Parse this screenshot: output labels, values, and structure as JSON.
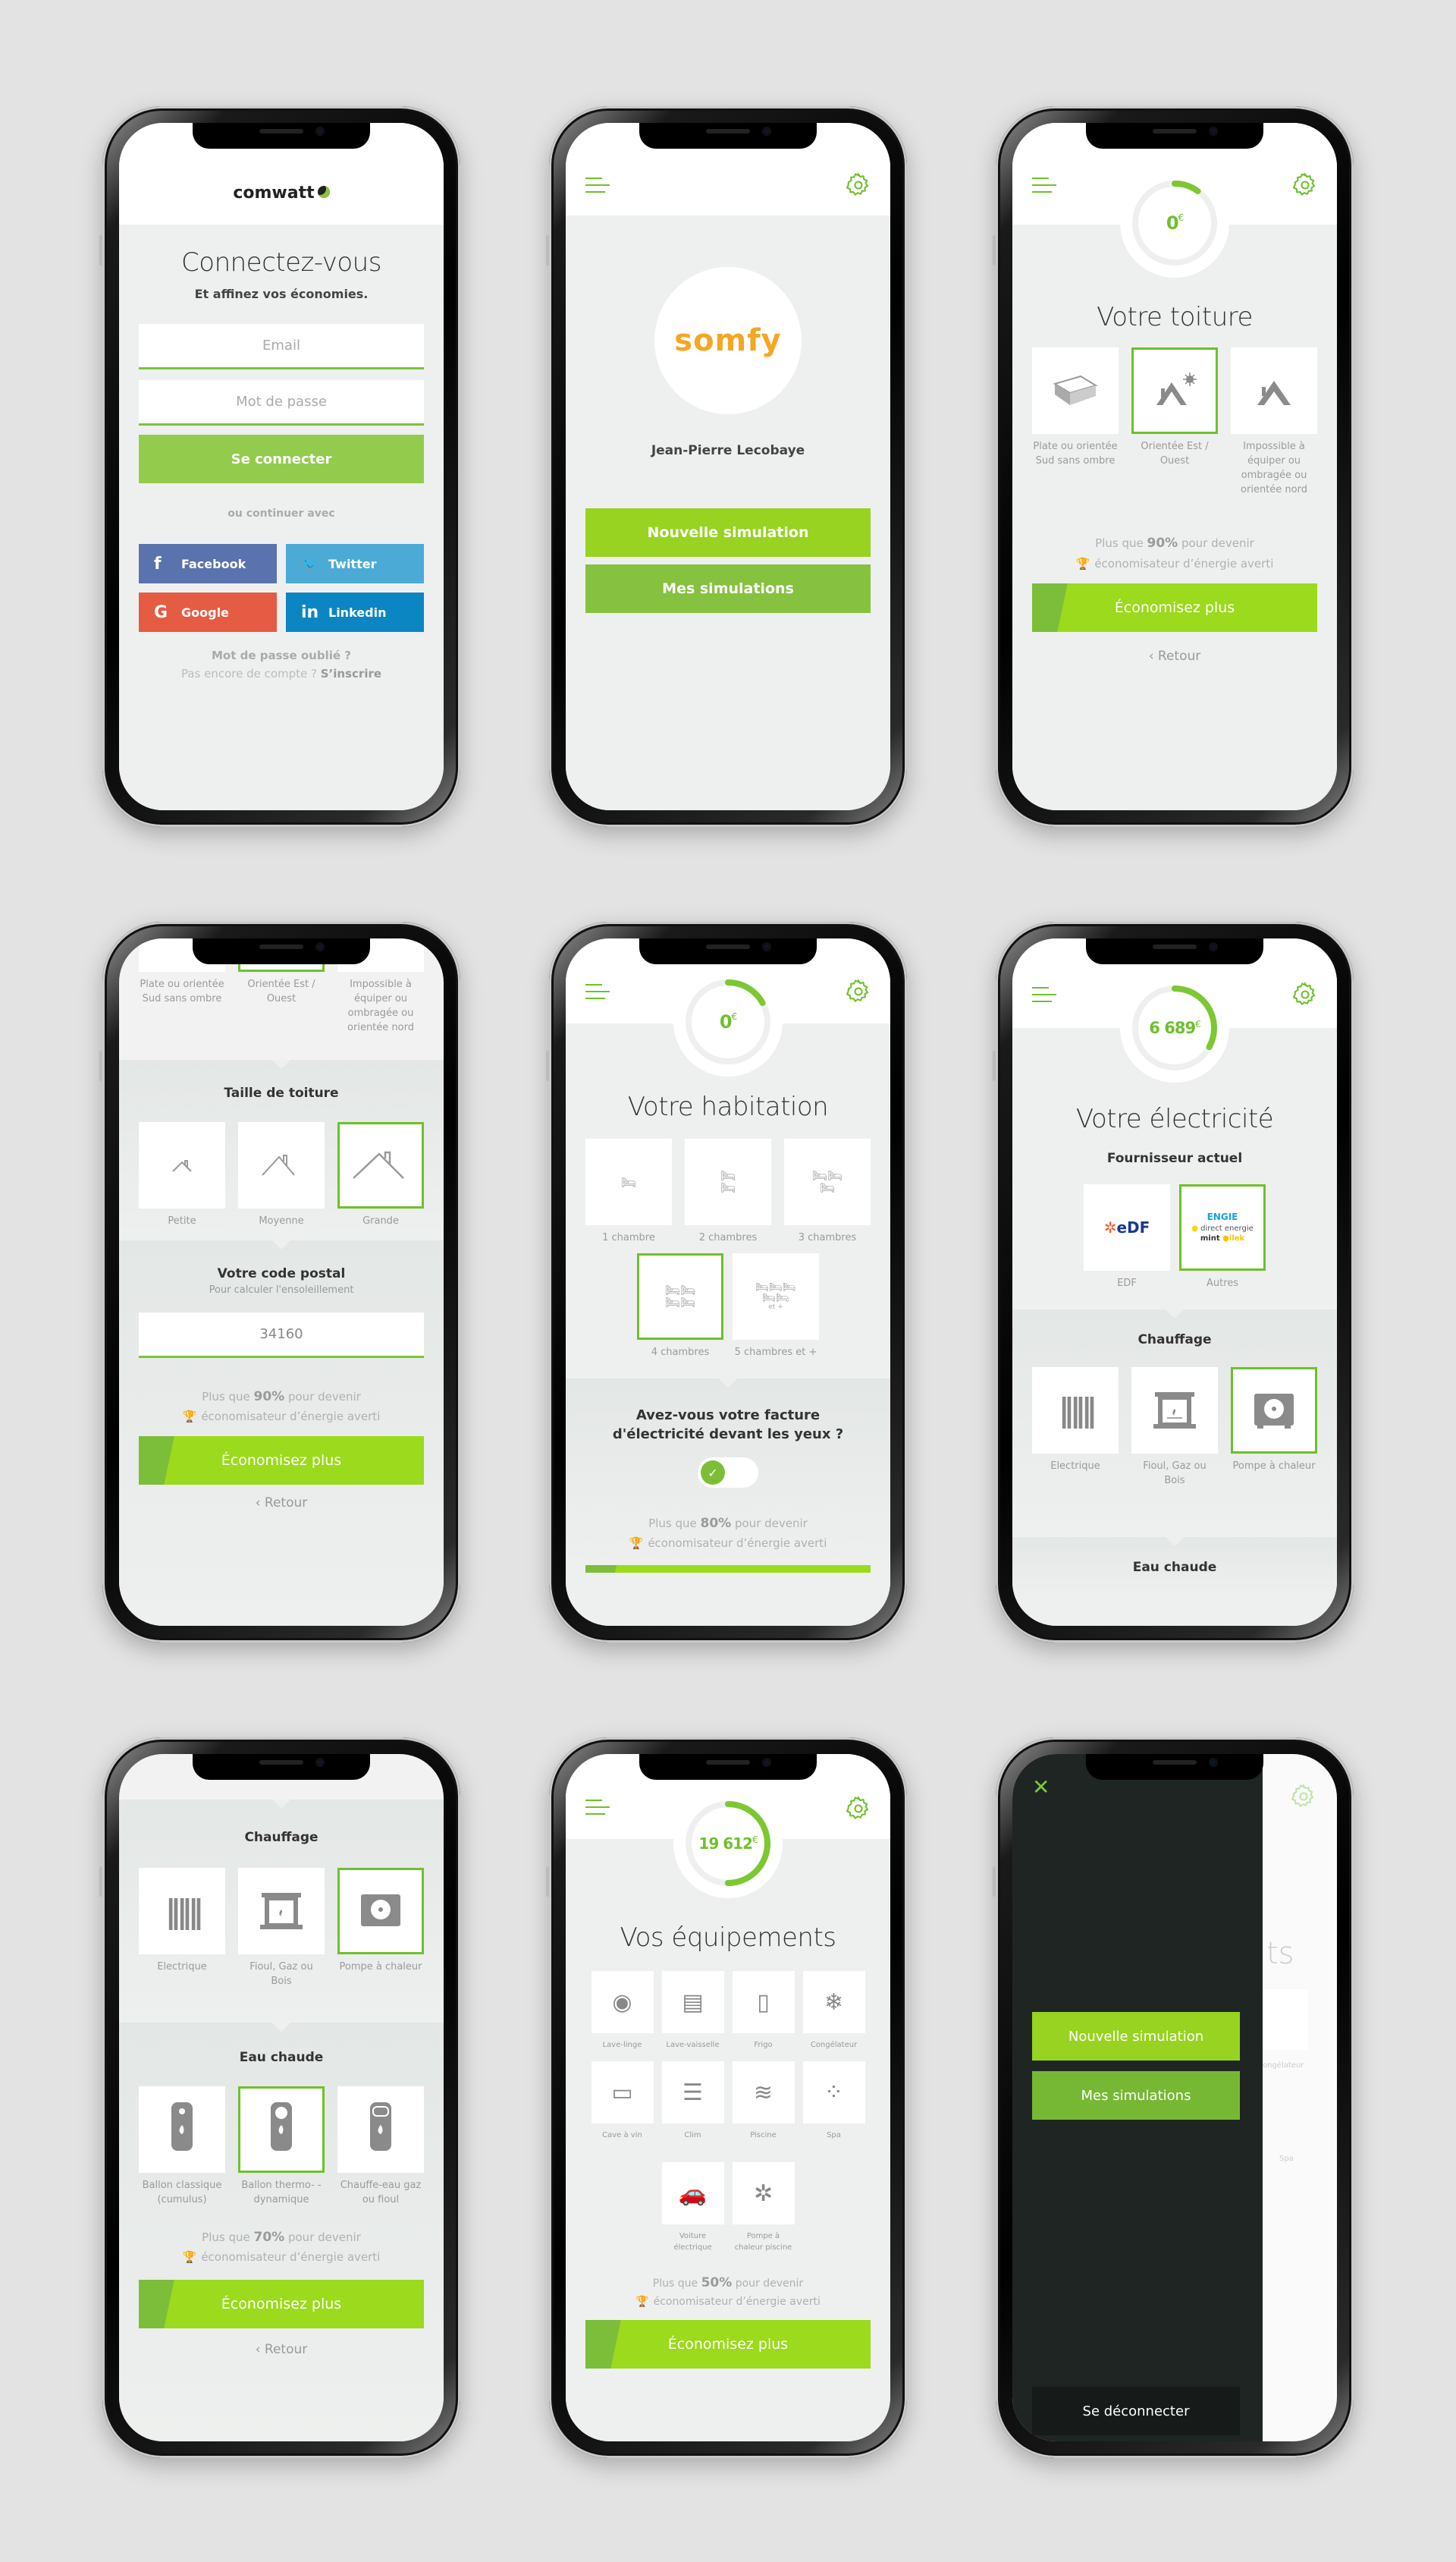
{
  "colors": {
    "accent": "#6fc02c",
    "lime": "#97d320",
    "green": "#86c140",
    "facebook": "#5a72ad",
    "twitter": "#4caad6",
    "google": "#e55b44",
    "linkedin": "#0b86c2",
    "drawer": "#1f2522"
  },
  "screens": {
    "login": {
      "logo": "comwatt",
      "title": "Connectez-vous",
      "subtitle": "Et affinez vos économies.",
      "email_placeholder": "Email",
      "password_placeholder": "Mot de passe",
      "login_button": "Se connecter",
      "or_continue": "ou continuer avec",
      "social": [
        {
          "label": "Facebook",
          "icon": "facebook-icon",
          "glyph": "f"
        },
        {
          "label": "Twitter",
          "icon": "twitter-icon",
          "glyph": "🐦"
        },
        {
          "label": "Google",
          "icon": "google-icon",
          "glyph": "G"
        },
        {
          "label": "Linkedin",
          "icon": "linkedin-icon",
          "glyph": "in"
        }
      ],
      "forgot_password": "Mot de passe oublié ?",
      "no_account": "Pas encore de compte ?",
      "signup": "S’inscrire"
    },
    "home": {
      "brand_logo": "somfy",
      "user_name": "Jean-Pierre Lecobaye",
      "new_simulation": "Nouvelle simulation",
      "my_simulations": "Mes simulations"
    },
    "roof": {
      "gauge_value": "0",
      "gauge_currency": "€",
      "gauge_progress": 0.1,
      "title": "Votre toiture",
      "options": [
        {
          "label": "Plate ou orientée Sud sans ombre",
          "icon": "flat-roof-icon",
          "selected": false
        },
        {
          "label": "Orientée Est / Ouest",
          "icon": "roof-sun-icon",
          "selected": true
        },
        {
          "label": "Impossible à équiper ou ombragée ou orientée nord",
          "icon": "roof-icon",
          "selected": false
        }
      ],
      "progress_prefix": "Plus que",
      "progress_percent": "90%",
      "progress_suffix": "pour devenir",
      "progress_line2": "économisateur d’énergie averti",
      "cta": "Économisez plus",
      "back": "Retour"
    },
    "roof_size": {
      "prev_options": [
        "Plate ou orientée Sud sans ombre",
        "Orientée Est / Ouest",
        "Impossible à équiper ou ombragée ou orientée nord"
      ],
      "section_title": "Taille de toiture",
      "options": [
        {
          "label": "Petite",
          "selected": false
        },
        {
          "label": "Moyenne",
          "selected": false
        },
        {
          "label": "Grande",
          "selected": true
        }
      ],
      "postal_title": "Votre code postal",
      "postal_subtitle": "Pour calculer l'ensoleillement",
      "postal_value": "34160",
      "progress_prefix": "Plus que",
      "progress_percent": "90%",
      "progress_suffix": "pour devenir",
      "progress_line2": "économisateur d’énergie averti",
      "cta": "Économisez plus",
      "back": "Retour"
    },
    "housing": {
      "gauge_value": "0",
      "gauge_currency": "€",
      "gauge_progress": 0.17,
      "title": "Votre habitation",
      "options": [
        {
          "label": "1 chambre",
          "beds": 1,
          "selected": false
        },
        {
          "label": "2 chambres",
          "beds": 2,
          "selected": false
        },
        {
          "label": "3 chambres",
          "beds": 3,
          "selected": false
        },
        {
          "label": "4 chambres",
          "beds": 4,
          "selected": true
        },
        {
          "label": "5 chambres et +",
          "beds": 5,
          "selected": false,
          "extra": "et +"
        }
      ],
      "question": "Avez-vous votre facture d'électricité devant les yeux ?",
      "toggle_on": true,
      "progress_prefix": "Plus que",
      "progress_percent": "80%",
      "progress_suffix": "pour devenir",
      "progress_line2": "économisateur d’énergie averti"
    },
    "electricity": {
      "gauge_value": "6 689",
      "gauge_currency": "€",
      "gauge_progress": 0.33,
      "title": "Votre électricité",
      "supplier_title": "Fournisseur actuel",
      "suppliers": [
        {
          "label": "EDF",
          "selected": false
        },
        {
          "label": "Autres",
          "selected": true,
          "logos": [
            "engie",
            "direct energie",
            "mint energie",
            "ilek"
          ]
        }
      ],
      "heating_title": "Chauffage",
      "heating": [
        {
          "label": "Electrique",
          "icon": "radiator-icon",
          "selected": false
        },
        {
          "label": "Fioul, Gaz ou Bois",
          "icon": "fireplace-icon",
          "selected": false
        },
        {
          "label": "Pompe à chaleur",
          "icon": "heat-pump-icon",
          "selected": true
        }
      ],
      "hot_water_title": "Eau chaude"
    },
    "heating": {
      "heating_title": "Chauffage",
      "heating": [
        {
          "label": "Electrique",
          "selected": false
        },
        {
          "label": "Fioul, Gaz ou Bois",
          "selected": false
        },
        {
          "label": "Pompe à chaleur",
          "selected": true
        }
      ],
      "hot_water_title": "Eau chaude",
      "hot_water": [
        {
          "label": "Ballon classique (cumulus)",
          "icon": "water-heater-icon",
          "selected": false
        },
        {
          "label": "Ballon thermo- -dynamique",
          "icon": "thermo-water-heater-icon",
          "selected": true
        },
        {
          "label": "Chauffe-eau gaz ou fioul",
          "icon": "gas-water-heater-icon",
          "selected": false
        }
      ],
      "progress_prefix": "Plus que",
      "progress_percent": "70%",
      "progress_suffix": "pour devenir",
      "progress_line2": "économisateur d’énergie averti",
      "cta": "Économisez plus",
      "back": "Retour"
    },
    "equipment": {
      "gauge_value": "19 612",
      "gauge_currency": "€",
      "gauge_progress": 0.5,
      "title": "Vos équipements",
      "items": [
        {
          "label": "Lave-linge",
          "icon": "washing-machine-icon",
          "glyph": "◉"
        },
        {
          "label": "Lave-vaisselle",
          "icon": "dishwasher-icon",
          "glyph": "▤"
        },
        {
          "label": "Frigo",
          "icon": "fridge-icon",
          "glyph": "▯"
        },
        {
          "label": "Congélateur",
          "icon": "freezer-icon",
          "glyph": "❄"
        },
        {
          "label": "Cave à vin",
          "icon": "wine-cellar-icon",
          "glyph": "▭"
        },
        {
          "label": "Clim",
          "icon": "air-conditioner-icon",
          "glyph": "☰"
        },
        {
          "label": "Piscine",
          "icon": "pool-icon",
          "glyph": "≋"
        },
        {
          "label": "Spa",
          "icon": "spa-icon",
          "glyph": "⁘"
        },
        {
          "label": "Voiture électrique",
          "icon": "electric-car-icon",
          "glyph": "🚗"
        },
        {
          "label": "Pompe à chaleur piscine",
          "icon": "pool-heat-pump-icon",
          "glyph": "✲"
        }
      ],
      "progress_prefix": "Plus que",
      "progress_percent": "50%",
      "progress_suffix": "pour devenir",
      "progress_line2": "économisateur d’énergie averti",
      "cta": "Économisez plus"
    },
    "drawer": {
      "new_simulation": "Nouvelle simulation",
      "my_simulations": "Mes simulations",
      "logout": "Se déconnecter",
      "behind_title_fragment": "ts",
      "behind_labels": [
        "ongélateur",
        "Spa"
      ]
    }
  }
}
